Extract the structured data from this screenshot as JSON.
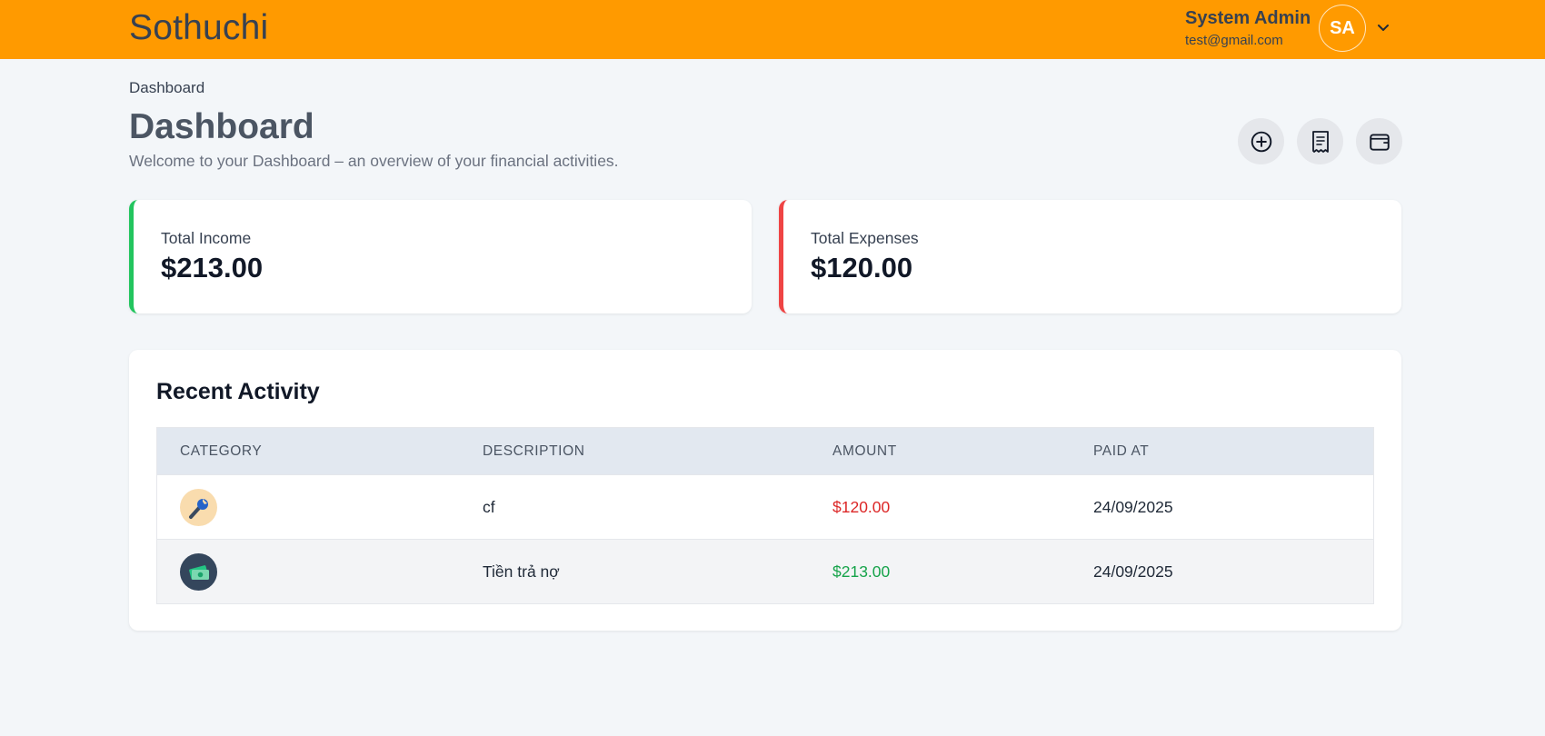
{
  "app": {
    "brand": "Sothuchi"
  },
  "user": {
    "name": "System Admin",
    "email": "test@gmail.com",
    "initials": "SA"
  },
  "breadcrumb": "Dashboard",
  "page": {
    "title": "Dashboard",
    "subtitle": "Welcome to your Dashboard – an overview of your financial activities."
  },
  "actions": [
    {
      "icon": "plus-circle-icon"
    },
    {
      "icon": "receipt-icon"
    },
    {
      "icon": "wallet-icon"
    }
  ],
  "stats": {
    "income": {
      "label": "Total Income",
      "value": "$213.00",
      "accent": "#22c55e"
    },
    "expense": {
      "label": "Total Expenses",
      "value": "$120.00",
      "accent": "#ef4444"
    }
  },
  "recent": {
    "title": "Recent Activity",
    "columns": [
      "CATEGORY",
      "DESCRIPTION",
      "AMOUNT",
      "PAID AT"
    ],
    "rows": [
      {
        "category_icon": "wrench-icon",
        "description": "cf",
        "amount": "$120.00",
        "type": "expense",
        "paid_at": "24/09/2025"
      },
      {
        "category_icon": "money-icon",
        "description": "Tiền trả nợ",
        "amount": "$213.00",
        "type": "income",
        "paid_at": "24/09/2025"
      }
    ]
  },
  "colors": {
    "header": "#ff9a00",
    "expense": "#dc2626",
    "income": "#16a34a"
  }
}
